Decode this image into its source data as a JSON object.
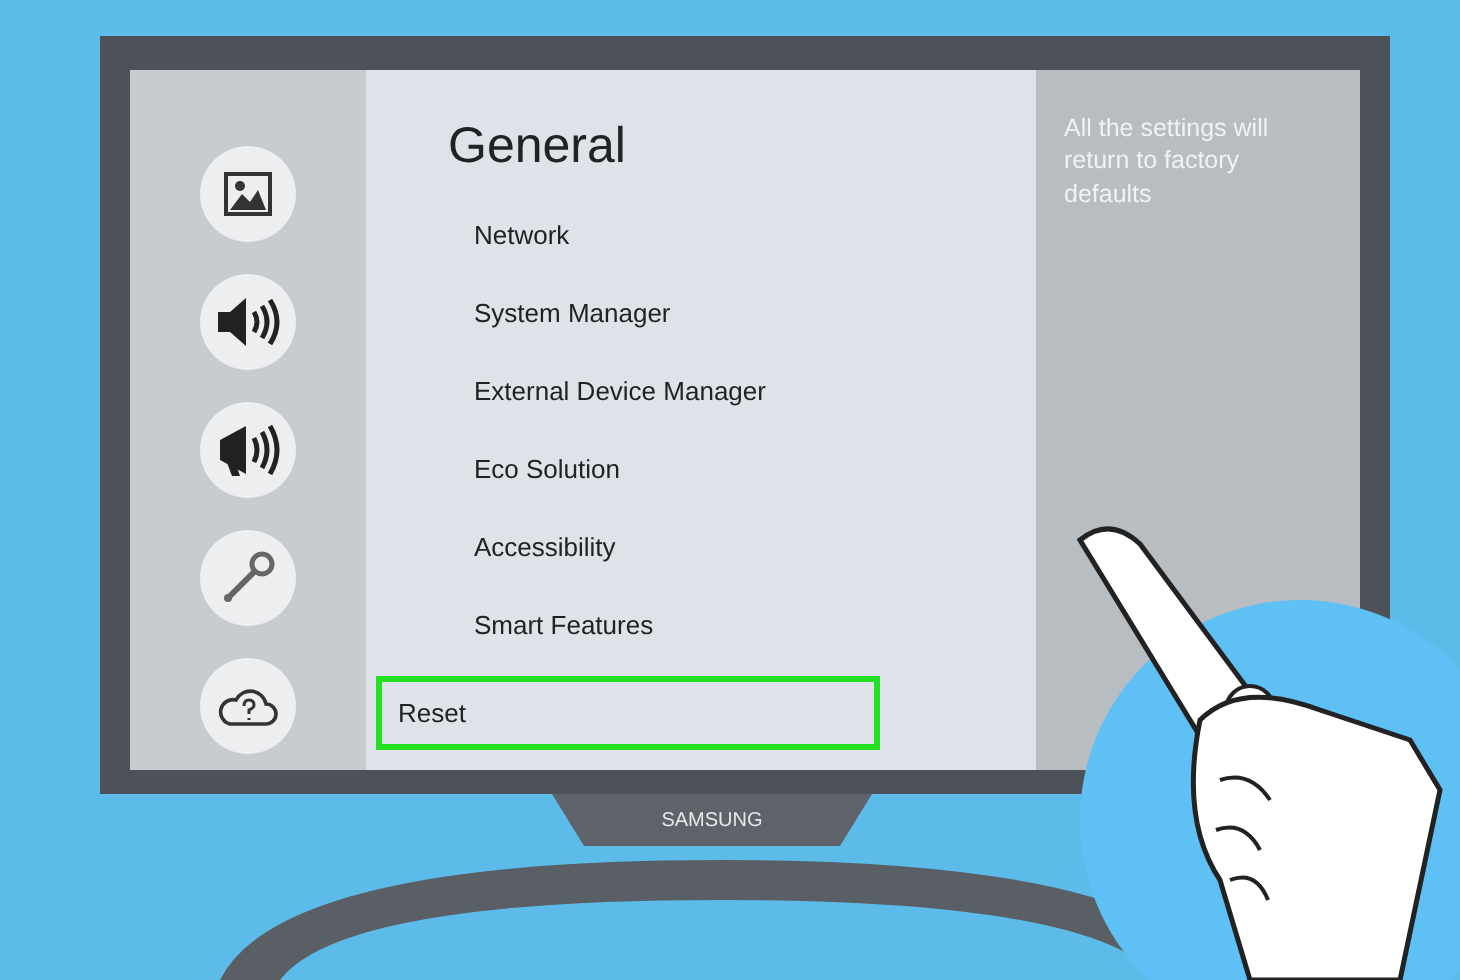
{
  "sidebar": {
    "icons": [
      {
        "kind": "picture"
      },
      {
        "kind": "sound"
      },
      {
        "kind": "broadcast"
      },
      {
        "kind": "tools"
      },
      {
        "kind": "support"
      }
    ]
  },
  "menu": {
    "title": "General",
    "items": [
      {
        "label": "Network",
        "selected": false
      },
      {
        "label": "System Manager",
        "selected": false
      },
      {
        "label": "External Device Manager",
        "selected": false
      },
      {
        "label": "Eco Solution",
        "selected": false
      },
      {
        "label": "Accessibility",
        "selected": false
      },
      {
        "label": "Smart Features",
        "selected": false
      },
      {
        "label": "Reset",
        "selected": true
      }
    ]
  },
  "info": {
    "text": "All the settings will return to factory defaults"
  },
  "tv": {
    "brand": "SAMSUNG"
  }
}
